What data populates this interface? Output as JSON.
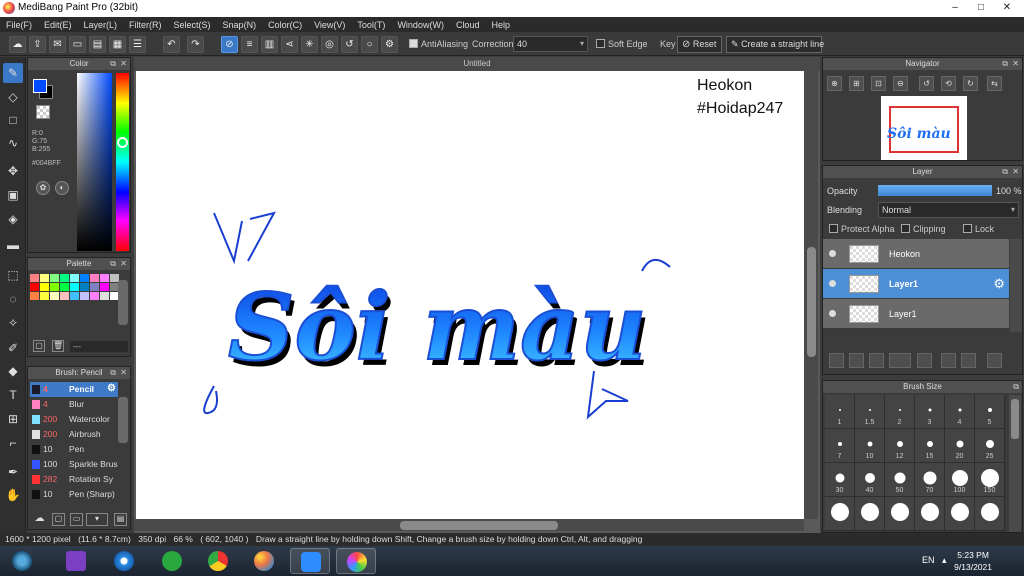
{
  "window": {
    "title": "MediBang Paint Pro (32bit)",
    "minimize": "–",
    "maximize": "□",
    "close": "✕"
  },
  "menu": [
    "File(F)",
    "Edit(E)",
    "Layer(L)",
    "Filter(R)",
    "Select(S)",
    "Snap(N)",
    "Color(C)",
    "View(V)",
    "Tool(T)",
    "Window(W)",
    "Cloud",
    "Help"
  ],
  "toolbar": {
    "antialiasing": "AntiAliasing",
    "correction_label": "Correction",
    "correction_value": "40",
    "soft_edge": "Soft Edge",
    "key_label": "Key",
    "reset": "Reset",
    "straight_line": "Create a straight line"
  },
  "color_panel": {
    "title": "Color",
    "r": "R:0",
    "g": "G:75",
    "b": "B:255",
    "hex": "#004BFF",
    "fg_color": "#004bff",
    "bg_color": "#000000"
  },
  "palette": {
    "title": "Palette",
    "colors": [
      "#ff8080",
      "#ffff80",
      "#80ff80",
      "#00ff80",
      "#80ffff",
      "#0080ff",
      "#ff80c0",
      "#ff80ff",
      "#c0c0c0",
      "#ff0000",
      "#ffff00",
      "#80ff00",
      "#00ff40",
      "#00ffff",
      "#0080c0",
      "#8080c0",
      "#ff00ff",
      "#808080",
      "#ff8040",
      "#ffff40",
      "#ffffc0",
      "#ffc0c0",
      "#40c0ff",
      "#c0c0ff",
      "#ff80ff",
      "#e0e0e0",
      "#ffffff"
    ],
    "name_placeholder": "---"
  },
  "brush_panel": {
    "title": "Brush: Pencil",
    "items": [
      {
        "size": "4",
        "name": "Pencil",
        "color": "#1a1a2a",
        "selected": true
      },
      {
        "size": "4",
        "name": "Blur",
        "color": "#ff80c0"
      },
      {
        "size": "200",
        "name": "Watercolor",
        "color": "#80e0ff"
      },
      {
        "size": "200",
        "name": "Airbrush",
        "color": "#e0e0e0"
      },
      {
        "size": "10",
        "name": "Pen",
        "color": "#111111",
        "plain": true
      },
      {
        "size": "100",
        "name": "Sparkle Brush",
        "color": "#3355ff",
        "plain": true
      },
      {
        "size": "282",
        "name": "Rotation Sy",
        "color": "#ff3333"
      },
      {
        "size": "10",
        "name": "Pen (Sharp)",
        "color": "#111111",
        "plain": true
      }
    ]
  },
  "canvas": {
    "tab": "Untitled",
    "watermark_name": "Heokon",
    "watermark_tag": "#Hoidap247",
    "artwork_text": "Sôi màu",
    "stroke_color": "#1a4fd6",
    "fill_color": "#22a7ff"
  },
  "navigator": {
    "title": "Navigator",
    "thumb_text": "Sôi màu"
  },
  "layer_panel": {
    "title": "Layer",
    "opacity_label": "Opacity",
    "opacity_value": "100 %",
    "opacity_fraction": 1.0,
    "blending_label": "Blending",
    "blending_value": "Normal",
    "protect_alpha": "Protect Alpha",
    "clipping": "Clipping",
    "lock": "Lock",
    "layers": [
      {
        "name": "Heokon",
        "selected": false
      },
      {
        "name": "Layer1",
        "selected": true
      },
      {
        "name": "Layer1",
        "selected": false
      }
    ]
  },
  "brush_size": {
    "title": "Brush Size",
    "sizes": [
      "1",
      "1.5",
      "2",
      "3",
      "4",
      "5",
      "7",
      "10",
      "12",
      "15",
      "20",
      "25",
      "30",
      "40",
      "50",
      "70",
      "100",
      "150",
      "",
      "",
      "",
      "",
      "",
      ""
    ]
  },
  "status": {
    "dimensions": "1600 * 1200 pixel",
    "physical": "(11.6 * 8.7cm)",
    "dpi": "350 dpi",
    "zoom": "66 %",
    "coords": "( 602, 1040 )",
    "hint": "Draw a straight line by holding down Shift, Change a brush size by holding down Ctrl, Alt, and dragging"
  },
  "taskbar": {
    "lang": "EN",
    "time": "5:23 PM",
    "date": "9/13/2021"
  }
}
